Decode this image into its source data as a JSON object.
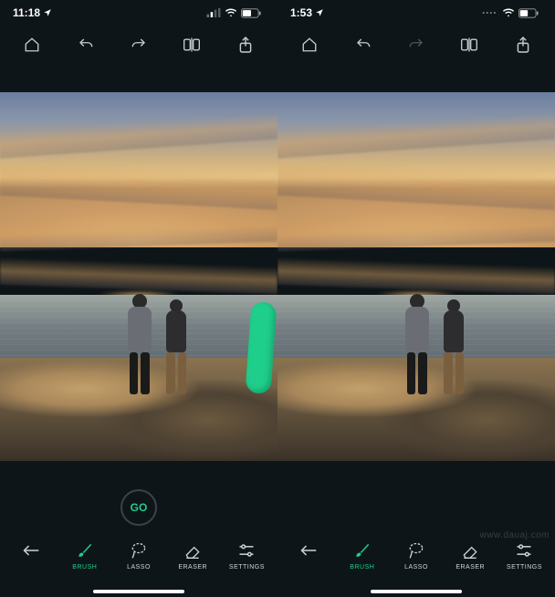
{
  "screens": [
    {
      "status": {
        "time": "11:18",
        "location_arrow": true,
        "signal_mode": "minimal"
      },
      "top_toolbar": {
        "home": {
          "enabled": true
        },
        "undo": {
          "enabled": true
        },
        "redo": {
          "enabled": true
        },
        "compare": {
          "enabled": true
        },
        "share": {
          "enabled": true
        }
      },
      "canvas": {
        "has_brush_stroke": true,
        "brush_color": "#1fce8a"
      },
      "action": {
        "go_label": "GO"
      },
      "tools": {
        "back": {
          "label": ""
        },
        "brush": {
          "label": "BRUSH",
          "active": true
        },
        "lasso": {
          "label": "LASSO",
          "active": false
        },
        "eraser": {
          "label": "ERASER",
          "active": false
        },
        "settings": {
          "label": "SETTINGS",
          "active": false
        }
      }
    },
    {
      "status": {
        "time": "1:53",
        "location_arrow": true,
        "signal_mode": "dots"
      },
      "top_toolbar": {
        "home": {
          "enabled": true
        },
        "undo": {
          "enabled": true
        },
        "redo": {
          "enabled": false
        },
        "compare": {
          "enabled": true
        },
        "share": {
          "enabled": true
        }
      },
      "canvas": {
        "has_brush_stroke": false
      },
      "action": {
        "go_label": ""
      },
      "tools": {
        "back": {
          "label": ""
        },
        "brush": {
          "label": "BRUSH",
          "active": true
        },
        "lasso": {
          "label": "LASSO",
          "active": false
        },
        "eraser": {
          "label": "ERASER",
          "active": false
        },
        "settings": {
          "label": "SETTINGS",
          "active": false
        }
      }
    }
  ],
  "watermark": "www.dauaj.com"
}
